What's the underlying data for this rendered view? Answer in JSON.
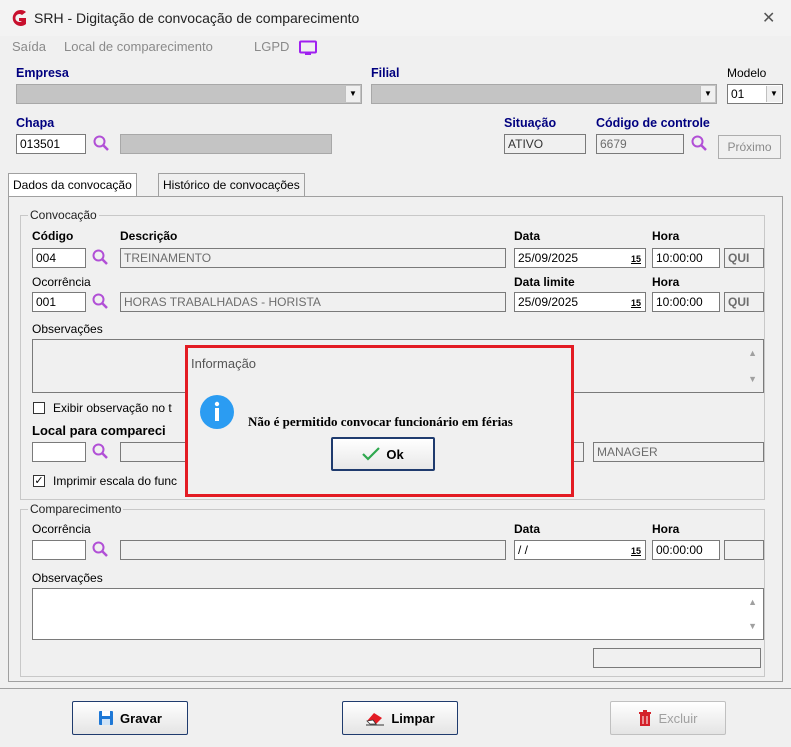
{
  "window": {
    "title": "SRH - Digitação de convocação de comparecimento"
  },
  "menu": {
    "item1": "Saída",
    "item2": "Local de comparecimento",
    "item3": "LGPD"
  },
  "header": {
    "empresa_label": "Empresa",
    "filial_label": "Filial",
    "modelo_label": "Modelo",
    "modelo_value": "01",
    "chapa_label": "Chapa",
    "chapa_value": "013501",
    "situacao_label": "Situação",
    "situacao_value": "ATIVO",
    "codigo_controle_label": "Código de controle",
    "codigo_controle_value": "6679",
    "proximo_label": "Próximo"
  },
  "tabs": {
    "tab1": "Dados da convocação",
    "tab2": "Histórico de convocações"
  },
  "convocacao": {
    "group_title": "Convocação",
    "codigo_label": "Código",
    "codigo_value": "004",
    "descricao_label": "Descrição",
    "descricao_value": "TREINAMENTO",
    "data_label": "Data",
    "data_value": "25/09/2025",
    "hora_label": "Hora",
    "hora_value": "10:00:00",
    "dia1": "QUI",
    "ocorrencia_label": "Ocorrência",
    "ocorrencia_value": "001",
    "ocorrencia_desc": "HORAS TRABALHADAS - HORISTA",
    "data_limite_label": "Data limite",
    "data_limite_value": "25/09/2025",
    "hora2_label": "Hora",
    "hora2_value": "10:00:00",
    "dia2": "QUI",
    "observacoes_label": "Observações",
    "exibir_obs_label": "Exibir observação no t",
    "local_label": "Local para compareci",
    "manager_value": "MANAGER",
    "imprimir_label": "Imprimir escala do func",
    "calendar_glyph": "15"
  },
  "comparecimento": {
    "group_title": "Comparecimento",
    "ocorrencia_label": "Ocorrência",
    "data_label": "Data",
    "data_value": " / /",
    "hora_label": "Hora",
    "hora_value": "00:00:00",
    "observacoes_label": "Observações"
  },
  "buttons": {
    "gravar": "Gravar",
    "limpar": "Limpar",
    "excluir": "Excluir"
  },
  "dialog": {
    "title": "Informação",
    "message": "Não é permitido convocar funcionário em férias",
    "ok": "Ok",
    "info_glyph": "i"
  },
  "colors": {
    "accent_label": "#00007f",
    "dialog_border": "#e31b23",
    "info_icon": "#2b9cf2",
    "lgpd_icon": "#a020f0"
  }
}
